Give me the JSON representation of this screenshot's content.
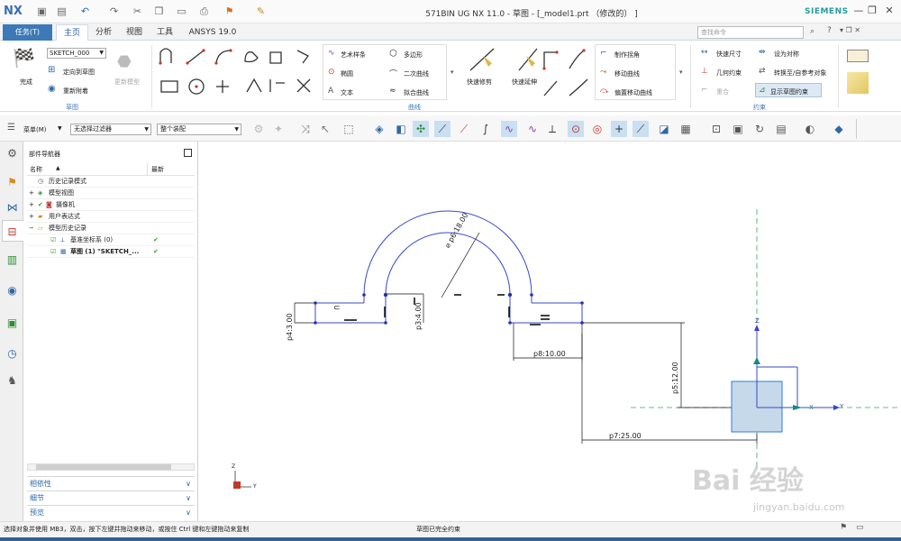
{
  "window": {
    "logo": "NX",
    "title": "571BIN UG NX 11.0 - 草图 - [_model1.prt （修改的） ]",
    "brand": "SIEMENS"
  },
  "tabs": {
    "task": "任务(T)",
    "items": [
      "主页",
      "分析",
      "视图",
      "工具",
      "ANSYS 19.0"
    ],
    "active": "主页"
  },
  "search": {
    "placeholder": "查找命令"
  },
  "ribbon": {
    "finish_label": "完成",
    "sketch_name": "SKETCH_000",
    "orient_label": "定向到草图",
    "reattach_label": "重新附着",
    "update_label": "更新模型",
    "group_sketch": "草图",
    "curve_tools": [
      "艺术样条",
      "椭圆",
      "文本",
      "多边形",
      "二次曲线",
      "拟合曲线"
    ],
    "quick_trim": "快速修剪",
    "quick_extend": "快速延伸",
    "corner_label": "制作拐角",
    "move_curve": "移动曲线",
    "offset_move": "偏置移动曲线",
    "group_curve": "曲线",
    "quick_dim": "快速尺寸",
    "geo_constraint": "几何约束",
    "overlap": "重合",
    "set_symmetric": "设为对称",
    "convert_ref": "转换至/自参考对象",
    "show_constraints": "显示草图约束",
    "group_constraint": "约束"
  },
  "toolbar": {
    "menu_label": "菜单(M)",
    "filter": "无选择过滤器",
    "assembly": "整个装配"
  },
  "navigator": {
    "title": "部件导航器",
    "col_name": "名称",
    "col_latest": "最新",
    "items": [
      {
        "label": "历史记录模式",
        "indent": 0
      },
      {
        "label": "模型视图",
        "indent": 0
      },
      {
        "label": "摄像机",
        "indent": 0
      },
      {
        "label": "用户表达式",
        "indent": 0
      },
      {
        "label": "模型历史记录",
        "indent": 0
      },
      {
        "label": "基准坐标系 (0)",
        "indent": 1
      },
      {
        "label": "草图 (1) \"SKETCH_...",
        "indent": 1
      }
    ],
    "panels": [
      "相依性",
      "细节",
      "预览"
    ]
  },
  "dimensions": {
    "d_diam": "⌀ p6:18.00",
    "d_p4": "p4:3.00",
    "d_p8_vert": "p3:4.00",
    "d_p8": "p8:10.00",
    "d_p5": "p5:12.00",
    "d_p7": "p7:25.00"
  },
  "csys": {
    "z": "Z",
    "x": "X",
    "y": "Y"
  },
  "status": {
    "left": "选择对象并使用 MB3，双击，按下左键并拖动来移动，或按住 Ctrl 键和左键拖动来复制",
    "center": "草图已完全约束"
  },
  "watermark": {
    "brand": "Bai 经验",
    "url": "jingyan.baidu.com"
  }
}
